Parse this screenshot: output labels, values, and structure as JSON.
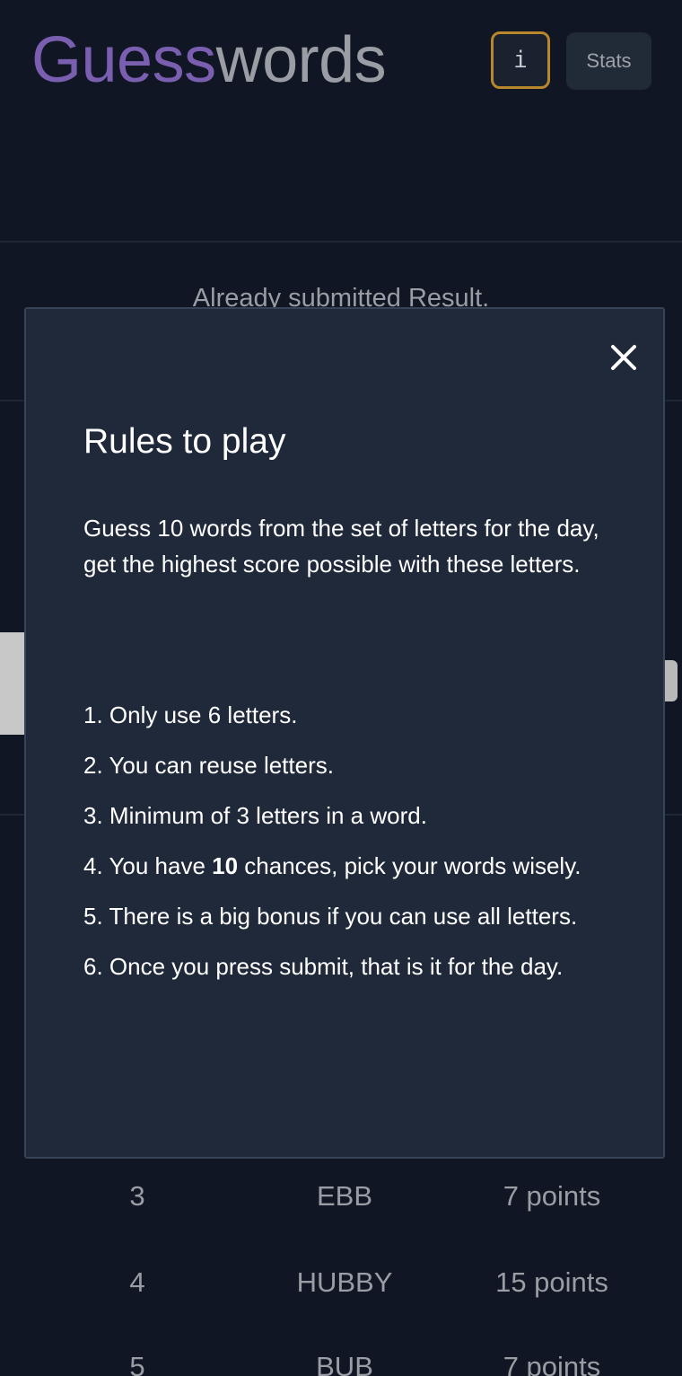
{
  "header": {
    "title_part1": "Guess",
    "title_part2": "words",
    "info_label": "i",
    "stats_label": "Stats"
  },
  "status": {
    "already_submitted": "Already submitted Result."
  },
  "modal": {
    "title": "Rules to play",
    "intro": "Guess 10 words from the set of letters for the day, get the highest score possible with these letters.",
    "rules": [
      "1. Only use 6 letters.",
      "2. You can reuse letters.",
      "3. Minimum of 3 letters in a word.",
      {
        "prefix": "4. You have ",
        "bold": "10",
        "suffix": " chances, pick your words wisely."
      },
      "5. There is a big bonus if you can use all letters.",
      "6. Once you press submit, that is it for the day."
    ]
  },
  "results": [
    {
      "number": "3",
      "word": "EBB",
      "points": "7 points"
    },
    {
      "number": "4",
      "word": "HUBBY",
      "points": "15 points"
    },
    {
      "number": "5",
      "word": "BUB",
      "points": "7 points"
    }
  ],
  "colors": {
    "background": "#101623",
    "title_accent": "#7a5fb0",
    "title_muted": "#9a9da3",
    "modal_bg": "#1f293a",
    "info_border": "#b8862b"
  }
}
